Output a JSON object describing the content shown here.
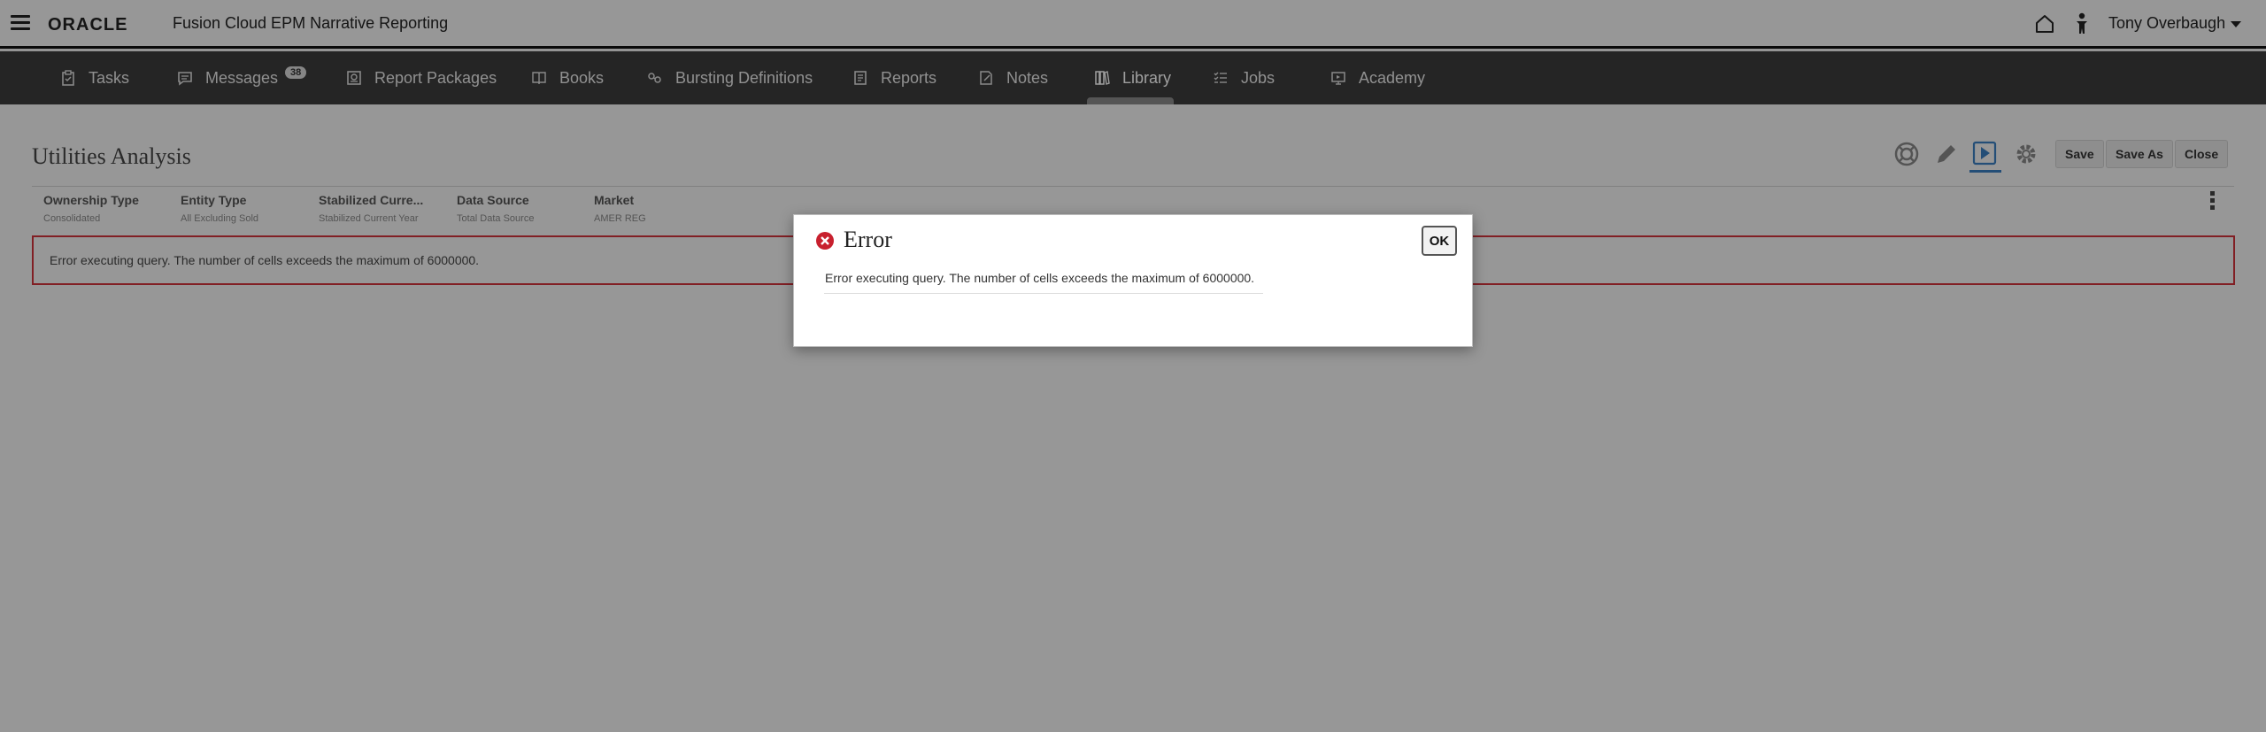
{
  "brand": {
    "logo_text": "ORACLE",
    "product_title": "Fusion Cloud EPM Narrative Reporting"
  },
  "header": {
    "user_name": "Tony Overbaugh",
    "home_icon": "home-icon",
    "accessibility_icon": "accessibility-person-icon"
  },
  "nav": {
    "items": [
      {
        "label": "Tasks",
        "icon": "clipboard-icon"
      },
      {
        "label": "Messages",
        "icon": "message-icon",
        "badge": "38"
      },
      {
        "label": "Report Packages",
        "icon": "report-package-icon"
      },
      {
        "label": "Books",
        "icon": "book-icon"
      },
      {
        "label": "Bursting Definitions",
        "icon": "bursting-icon"
      },
      {
        "label": "Reports",
        "icon": "report-icon"
      },
      {
        "label": "Notes",
        "icon": "note-icon"
      },
      {
        "label": "Library",
        "icon": "library-icon",
        "active": true
      },
      {
        "label": "Jobs",
        "icon": "jobs-icon"
      },
      {
        "label": "Academy",
        "icon": "academy-icon"
      }
    ]
  },
  "report": {
    "title": "Utilities Analysis",
    "toolbar": {
      "save_label": "Save",
      "save_as_label": "Save As",
      "close_label": "Close"
    },
    "pov": [
      {
        "dimension": "Ownership Type",
        "member": "Consolidated"
      },
      {
        "dimension": "Entity Type",
        "member": "All Excluding Sold"
      },
      {
        "dimension": "Stabilized Curre...",
        "member": "Stabilized Current Year"
      },
      {
        "dimension": "Data Source",
        "member": "Total Data Source"
      },
      {
        "dimension": "Market",
        "member": "AMER REG"
      }
    ],
    "error_banner": "Error executing query. The number of cells exceeds the maximum of 6000000."
  },
  "dialog": {
    "title": "Error",
    "message": "Error executing query. The number of cells exceeds the maximum of 6000000.",
    "ok_label": "OK"
  },
  "colors": {
    "nav_background": "#3c3c3c",
    "error_red": "#d0333a",
    "active_play": "#3a7fc1"
  }
}
